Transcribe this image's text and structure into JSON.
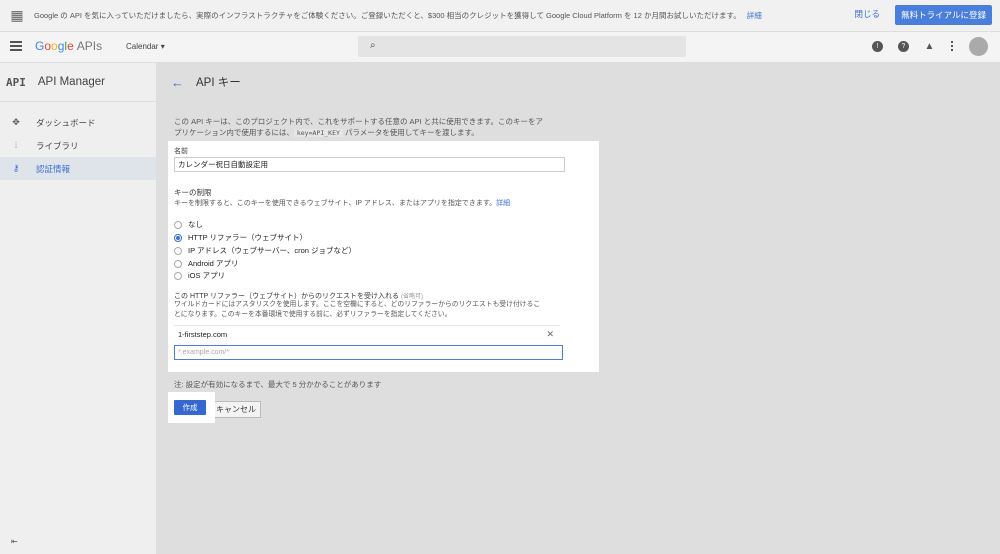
{
  "promo": {
    "message": "Google の API を気に入っていただけましたら、実際のインフラストラクチャをご体験ください。ご登録いただくと、$300 相当のクレジットを獲得して Google Cloud Platform を 12 か月間お試しいただけます。",
    "more_link": "詳細",
    "close_label": "閉じる",
    "trial_label": "無料トライアルに登録"
  },
  "topbar": {
    "logo": [
      "G",
      "o",
      "o",
      "g",
      "l",
      "e"
    ],
    "logo_suffix": "APIs",
    "project": "Calendar ▾"
  },
  "sidebar": {
    "logo": "API",
    "title": "API Manager",
    "items": [
      {
        "label": "ダッシュボード",
        "icon": "dashboard-icon"
      },
      {
        "label": "ライブラリ",
        "icon": "library-icon"
      },
      {
        "label": "認証情報",
        "icon": "key-icon"
      }
    ]
  },
  "page": {
    "title": "API キー",
    "intro_1": "この API キーは、このプロジェクト内で、これをサポートする任意の API と共に使用できます。このキーをア",
    "intro_2a": "プリケーション内で使用するには、",
    "intro_code": "key=API_KEY",
    "intro_2b": " パラメータを使用してキーを渡します。"
  },
  "form": {
    "name_label": "名前",
    "name_value": "カレンダー祝日自動設定用",
    "restriction_title": "キーの制限",
    "restriction_desc": "キーを制限すると、このキーを使用できるウェブサイト、IP アドレス、またはアプリを指定できます。",
    "restriction_link": "詳細",
    "options": [
      {
        "label": "なし",
        "selected": false
      },
      {
        "label": "HTTP リファラー（ウェブサイト）",
        "selected": true
      },
      {
        "label": "IP アドレス（ウェブサーバー、cron ジョブなど）",
        "selected": false
      },
      {
        "label": "Android アプリ",
        "selected": false
      },
      {
        "label": "iOS アプリ",
        "selected": false
      }
    ],
    "referrer_title": "この HTTP リファラー（ウェブサイト）からのリクエストを受け入れる",
    "referrer_optional": "(省略可)",
    "referrer_desc_1": "ワイルドカードにはアスタリスクを使用します。ここを空欄にすると、どのリファラーからのリクエストも受け付けるこ",
    "referrer_desc_2": "とになります。このキーを本番環境で使用する前に、必ずリファラーを指定してください。",
    "referrer_value": "1-firststep.com",
    "referrer_placeholder": "*.example.com/*"
  },
  "footer": {
    "note": "注: 設定が有効になるまで、最大で 5 分かかることがあります",
    "create_label": "作成",
    "cancel_label": "キャンセル"
  },
  "colors": {
    "accent": "#3b6fd2",
    "primary_button": "#3467d0"
  }
}
